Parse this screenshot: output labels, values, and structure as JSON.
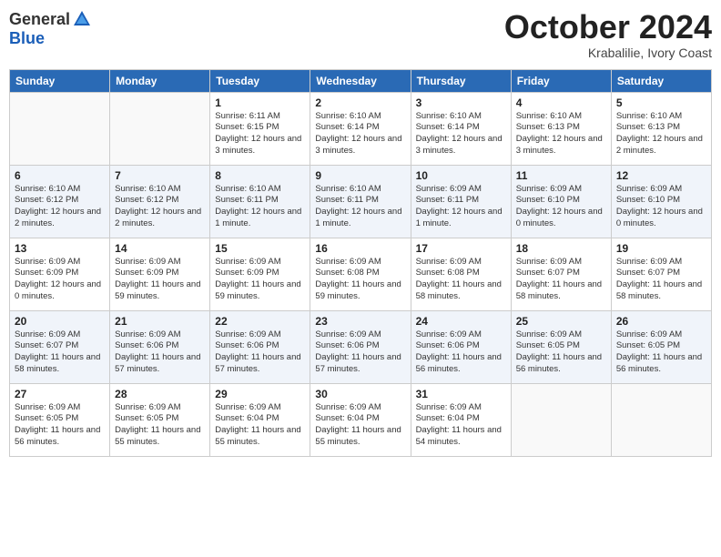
{
  "header": {
    "logo_general": "General",
    "logo_blue": "Blue",
    "month_title": "October 2024",
    "subtitle": "Krabalilie, Ivory Coast"
  },
  "weekdays": [
    "Sunday",
    "Monday",
    "Tuesday",
    "Wednesday",
    "Thursday",
    "Friday",
    "Saturday"
  ],
  "weeks": [
    [
      {
        "day": "",
        "info": ""
      },
      {
        "day": "",
        "info": ""
      },
      {
        "day": "1",
        "info": "Sunrise: 6:11 AM\nSunset: 6:15 PM\nDaylight: 12 hours and 3 minutes."
      },
      {
        "day": "2",
        "info": "Sunrise: 6:10 AM\nSunset: 6:14 PM\nDaylight: 12 hours and 3 minutes."
      },
      {
        "day": "3",
        "info": "Sunrise: 6:10 AM\nSunset: 6:14 PM\nDaylight: 12 hours and 3 minutes."
      },
      {
        "day": "4",
        "info": "Sunrise: 6:10 AM\nSunset: 6:13 PM\nDaylight: 12 hours and 3 minutes."
      },
      {
        "day": "5",
        "info": "Sunrise: 6:10 AM\nSunset: 6:13 PM\nDaylight: 12 hours and 2 minutes."
      }
    ],
    [
      {
        "day": "6",
        "info": "Sunrise: 6:10 AM\nSunset: 6:12 PM\nDaylight: 12 hours and 2 minutes."
      },
      {
        "day": "7",
        "info": "Sunrise: 6:10 AM\nSunset: 6:12 PM\nDaylight: 12 hours and 2 minutes."
      },
      {
        "day": "8",
        "info": "Sunrise: 6:10 AM\nSunset: 6:11 PM\nDaylight: 12 hours and 1 minute."
      },
      {
        "day": "9",
        "info": "Sunrise: 6:10 AM\nSunset: 6:11 PM\nDaylight: 12 hours and 1 minute."
      },
      {
        "day": "10",
        "info": "Sunrise: 6:09 AM\nSunset: 6:11 PM\nDaylight: 12 hours and 1 minute."
      },
      {
        "day": "11",
        "info": "Sunrise: 6:09 AM\nSunset: 6:10 PM\nDaylight: 12 hours and 0 minutes."
      },
      {
        "day": "12",
        "info": "Sunrise: 6:09 AM\nSunset: 6:10 PM\nDaylight: 12 hours and 0 minutes."
      }
    ],
    [
      {
        "day": "13",
        "info": "Sunrise: 6:09 AM\nSunset: 6:09 PM\nDaylight: 12 hours and 0 minutes."
      },
      {
        "day": "14",
        "info": "Sunrise: 6:09 AM\nSunset: 6:09 PM\nDaylight: 11 hours and 59 minutes."
      },
      {
        "day": "15",
        "info": "Sunrise: 6:09 AM\nSunset: 6:09 PM\nDaylight: 11 hours and 59 minutes."
      },
      {
        "day": "16",
        "info": "Sunrise: 6:09 AM\nSunset: 6:08 PM\nDaylight: 11 hours and 59 minutes."
      },
      {
        "day": "17",
        "info": "Sunrise: 6:09 AM\nSunset: 6:08 PM\nDaylight: 11 hours and 58 minutes."
      },
      {
        "day": "18",
        "info": "Sunrise: 6:09 AM\nSunset: 6:07 PM\nDaylight: 11 hours and 58 minutes."
      },
      {
        "day": "19",
        "info": "Sunrise: 6:09 AM\nSunset: 6:07 PM\nDaylight: 11 hours and 58 minutes."
      }
    ],
    [
      {
        "day": "20",
        "info": "Sunrise: 6:09 AM\nSunset: 6:07 PM\nDaylight: 11 hours and 58 minutes."
      },
      {
        "day": "21",
        "info": "Sunrise: 6:09 AM\nSunset: 6:06 PM\nDaylight: 11 hours and 57 minutes."
      },
      {
        "day": "22",
        "info": "Sunrise: 6:09 AM\nSunset: 6:06 PM\nDaylight: 11 hours and 57 minutes."
      },
      {
        "day": "23",
        "info": "Sunrise: 6:09 AM\nSunset: 6:06 PM\nDaylight: 11 hours and 57 minutes."
      },
      {
        "day": "24",
        "info": "Sunrise: 6:09 AM\nSunset: 6:06 PM\nDaylight: 11 hours and 56 minutes."
      },
      {
        "day": "25",
        "info": "Sunrise: 6:09 AM\nSunset: 6:05 PM\nDaylight: 11 hours and 56 minutes."
      },
      {
        "day": "26",
        "info": "Sunrise: 6:09 AM\nSunset: 6:05 PM\nDaylight: 11 hours and 56 minutes."
      }
    ],
    [
      {
        "day": "27",
        "info": "Sunrise: 6:09 AM\nSunset: 6:05 PM\nDaylight: 11 hours and 56 minutes."
      },
      {
        "day": "28",
        "info": "Sunrise: 6:09 AM\nSunset: 6:05 PM\nDaylight: 11 hours and 55 minutes."
      },
      {
        "day": "29",
        "info": "Sunrise: 6:09 AM\nSunset: 6:04 PM\nDaylight: 11 hours and 55 minutes."
      },
      {
        "day": "30",
        "info": "Sunrise: 6:09 AM\nSunset: 6:04 PM\nDaylight: 11 hours and 55 minutes."
      },
      {
        "day": "31",
        "info": "Sunrise: 6:09 AM\nSunset: 6:04 PM\nDaylight: 11 hours and 54 minutes."
      },
      {
        "day": "",
        "info": ""
      },
      {
        "day": "",
        "info": ""
      }
    ]
  ]
}
